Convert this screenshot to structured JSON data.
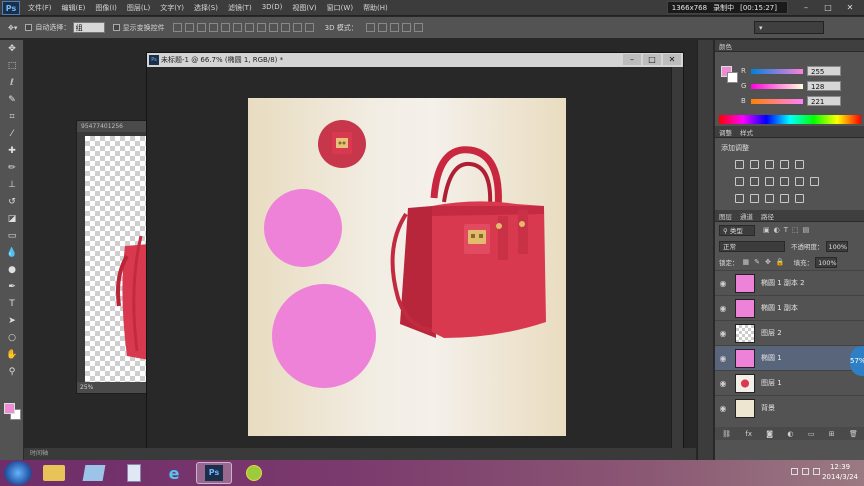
{
  "menubar": {
    "app_logo": "Ps",
    "menus": [
      "文件(F)",
      "编辑(E)",
      "图像(I)",
      "图层(L)",
      "文字(Y)",
      "选择(S)",
      "滤镜(T)",
      "3D(D)",
      "视图(V)",
      "窗口(W)",
      "帮助(H)"
    ],
    "recorder": {
      "resolution": "1366x768",
      "status": "录制中",
      "time": "[00:15:27]"
    }
  },
  "options": {
    "auto_select_label": "自动选择：",
    "auto_select_value": "组",
    "show_transform_label": "显示变换控件",
    "mode_3d_label": "3D 模式："
  },
  "doc2": {
    "title": "95477401256",
    "zoom": "25%"
  },
  "doc1": {
    "title": "未标题-1 @ 66.7% (椭圆 1, RGB/8) *"
  },
  "color_panel": {
    "tab": "颜色",
    "r_label": "R",
    "r_value": "255",
    "g_label": "G",
    "g_value": "128",
    "b_label": "B",
    "b_value": "221"
  },
  "adjust_panel": {
    "tabs": [
      "调整",
      "样式"
    ],
    "title": "添加调整"
  },
  "layers_panel": {
    "tabs": [
      "图层",
      "通道",
      "路径"
    ],
    "filter_label": "类型",
    "blend_mode": "正常",
    "opacity_label": "不透明度：",
    "opacity_value": "100%",
    "lock_label": "锁定：",
    "fill_label": "填充：",
    "fill_value": "100%",
    "layers": [
      {
        "name": "椭圆 1 副本 2"
      },
      {
        "name": "椭圆 1 副本"
      },
      {
        "name": "图层 2"
      },
      {
        "name": "椭圆 1"
      },
      {
        "name": "图层 1"
      },
      {
        "name": "背景"
      }
    ],
    "side_badge": "57%"
  },
  "timeline": {
    "label": "时间轴"
  },
  "taskbar": {
    "ps_label": "Ps",
    "time": "12:39",
    "date": "2014/3/24"
  },
  "colors": {
    "foreground": "#ef8cd6",
    "circle_fill": "#ee82d8",
    "bag": "#d9394e"
  }
}
